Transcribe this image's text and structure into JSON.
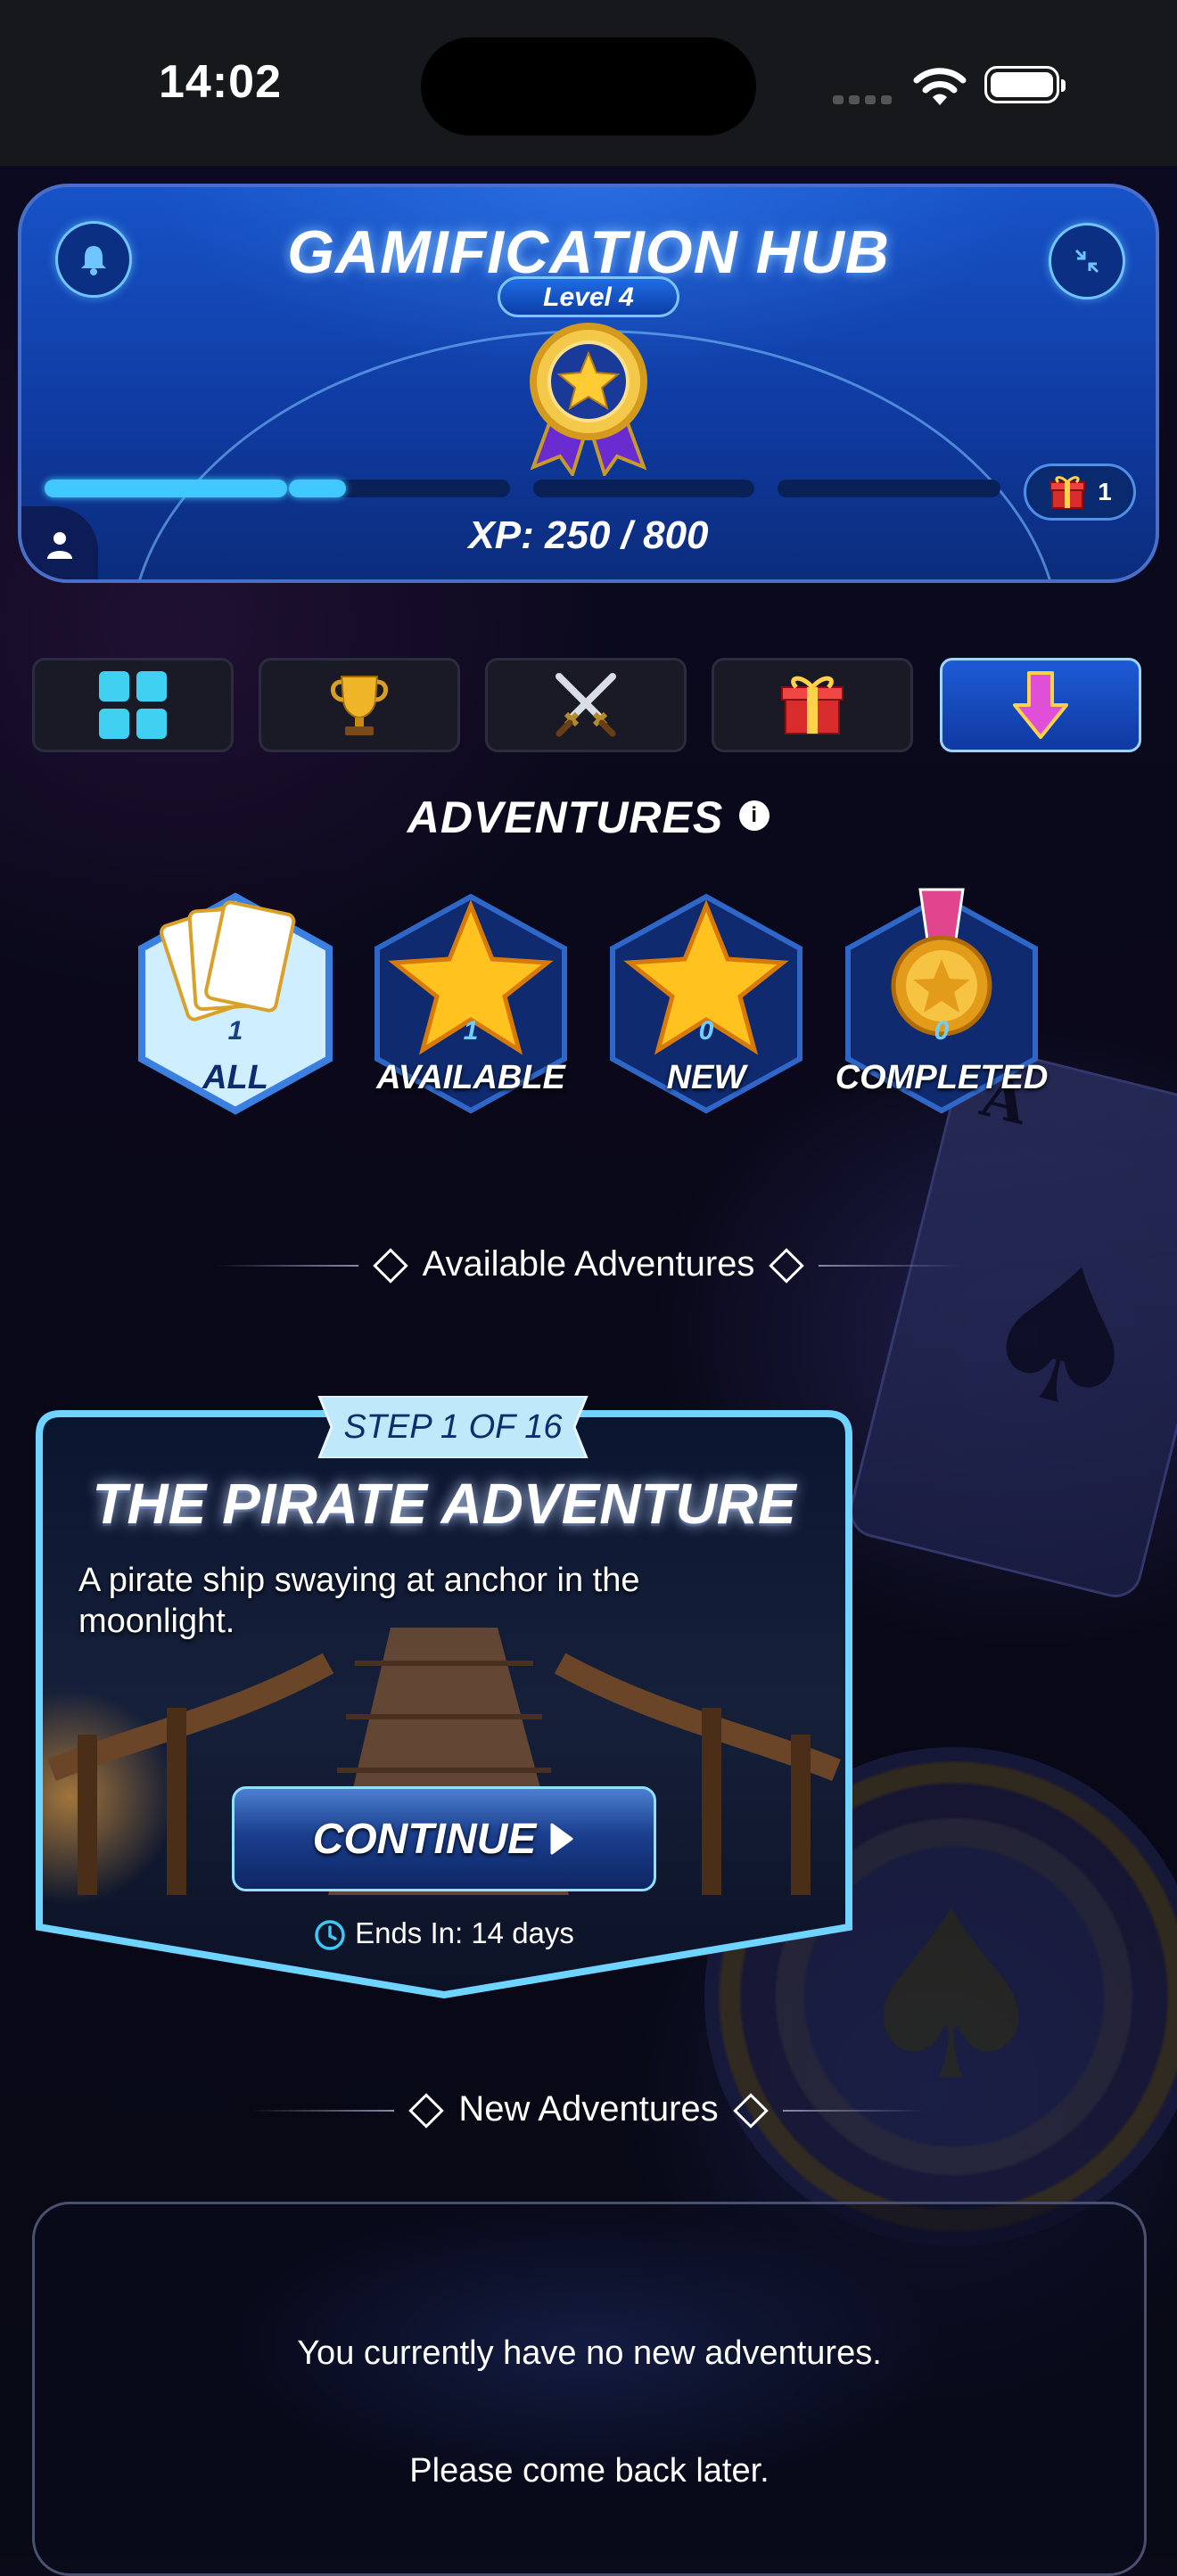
{
  "status_bar": {
    "time": "14:02"
  },
  "hub": {
    "title": "GAMIFICATION HUB",
    "level": "Level 4",
    "xp_text": "XP: 250 / 800",
    "xp_progress": 0.3125,
    "rewards_count": "1"
  },
  "tabs": [
    {
      "icon": "grid-icon",
      "active": false
    },
    {
      "icon": "trophy-icon",
      "active": false
    },
    {
      "icon": "crossed-swords-icon",
      "active": false
    },
    {
      "icon": "gift-icon",
      "active": false
    },
    {
      "icon": "download-arrow-icon",
      "active": true
    }
  ],
  "section_title": "ADVENTURES",
  "filters": [
    {
      "count": "1",
      "label": "ALL",
      "icon": "cards-icon"
    },
    {
      "count": "1",
      "label": "AVAILABLE",
      "icon": "star-icon"
    },
    {
      "count": "0",
      "label": "NEW",
      "icon": "star-icon"
    },
    {
      "count": "0",
      "label": "COMPLETED",
      "icon": "medal-icon"
    }
  ],
  "available_heading": "Available Adventures",
  "adventure": {
    "step": "STEP 1 OF 16",
    "title": "THE PIRATE ADVENTURE",
    "description": "A pirate ship swaying at anchor in the moonlight.",
    "button": "CONTINUE",
    "ends_label": "Ends In:",
    "ends_value": "14 days"
  },
  "new_heading": "New Adventures",
  "new_empty": {
    "line1": "You currently have no new adventures.",
    "line2": "Please come back later."
  },
  "colors": {
    "accent": "#41c8ff",
    "hub_blue": "#1753c8",
    "background": "#0a0a18"
  }
}
